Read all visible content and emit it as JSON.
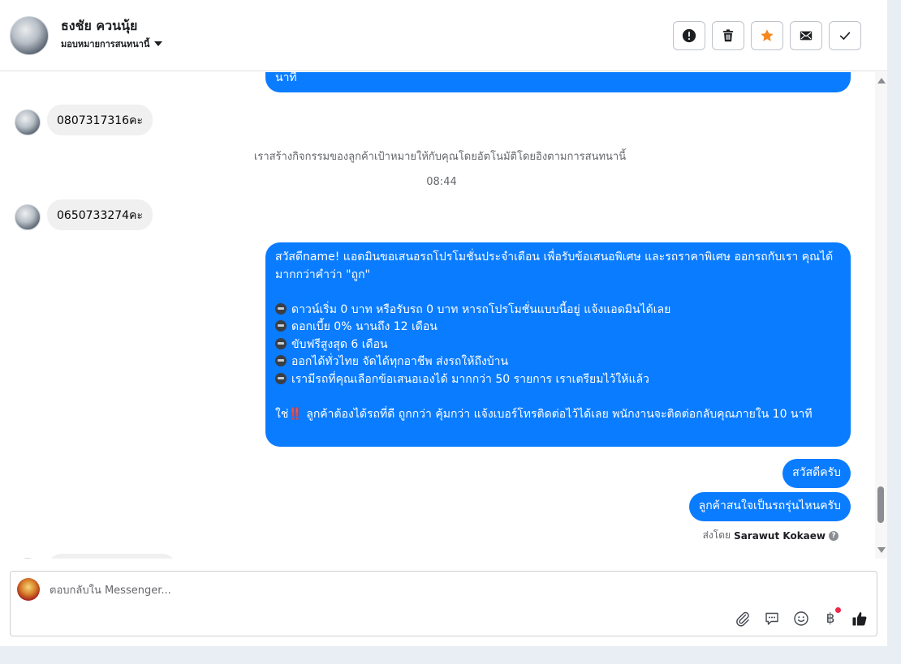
{
  "header": {
    "contact_name": "ธงชัย ควนนุ้ย",
    "assign_label": "มอบหมายการสนทนานี้",
    "actions": [
      {
        "name": "report-button",
        "icon": "alert-circle-icon"
      },
      {
        "name": "delete-button",
        "icon": "trash-icon"
      },
      {
        "name": "star-button",
        "icon": "star-icon"
      },
      {
        "name": "mark-unread-button",
        "icon": "envelope-icon"
      },
      {
        "name": "mark-done-button",
        "icon": "check-icon"
      }
    ],
    "star_color": "#f5891f"
  },
  "messages": {
    "top_partial_text": "นาที",
    "in_1": "0807317316คะ",
    "system_note": "เราสร้างกิจกรรมของลูกค้าเป้าหมายให้กับคุณโดยอัตโนมัติโดยอิงตามการสนทนานี้",
    "timestamp": "08:44",
    "in_2": "0650733274คะ",
    "promo": {
      "intro": "สวัสดีname! แอดมินขอเสนอรถโปรโมชั่นประจำเดือน เพื่อรับข้อเสนอพิเศษ และรถราคาพิเศษ ออกรถกับเรา คุณได้มากกว่าคำว่า \"ถูก\"",
      "bullets": [
        "ดาวน์เริ่ม 0 บาท หรือรับรถ 0 บาท หารถโปรโมชั่นแบบนี้อยู่ แจ้งแอดมินได้เลย",
        "ดอกเบี้ย 0% นานถึง 12 เดือน",
        "ขับฟรีสูงสุด 6 เดือน",
        "ออกได้ทั่วไทย จัดได้ทุกอาชีพ ส่งรถให้ถึงบ้าน",
        "เรามีรถที่คุณเลือกข้อเสนอเองได้ มากกว่า 50 รายการ เราเตรียมไว้ให้แล้ว"
      ],
      "closing_prefix": "ใช่",
      "closing_mark": "‼️",
      "closing_text": "ลูกค้าต้องได้รถที่ดี ถูกกว่า คุ้มกว่า แจ้งเบอร์โทรติดต่อไว้ได้เลย พนักงานจะติดต่อกลับคุณภายใน 10 นาที"
    },
    "out_greeting": "สวัสดีครับ",
    "out_question": "ลูกค้าสนใจเป็นรถรุ่นไหนครับ",
    "sent_by_label": "ส่งโดย",
    "sent_by_name": "Sarawut Kokaew",
    "bubble_color": "#0a7cff"
  },
  "composer": {
    "placeholder": "ตอบกลับใน Messenger...",
    "tools": [
      "paperclip-icon",
      "quick-reply-icon",
      "emoji-icon",
      "payment-icon",
      "like-icon"
    ],
    "payment_symbol": "฿"
  }
}
